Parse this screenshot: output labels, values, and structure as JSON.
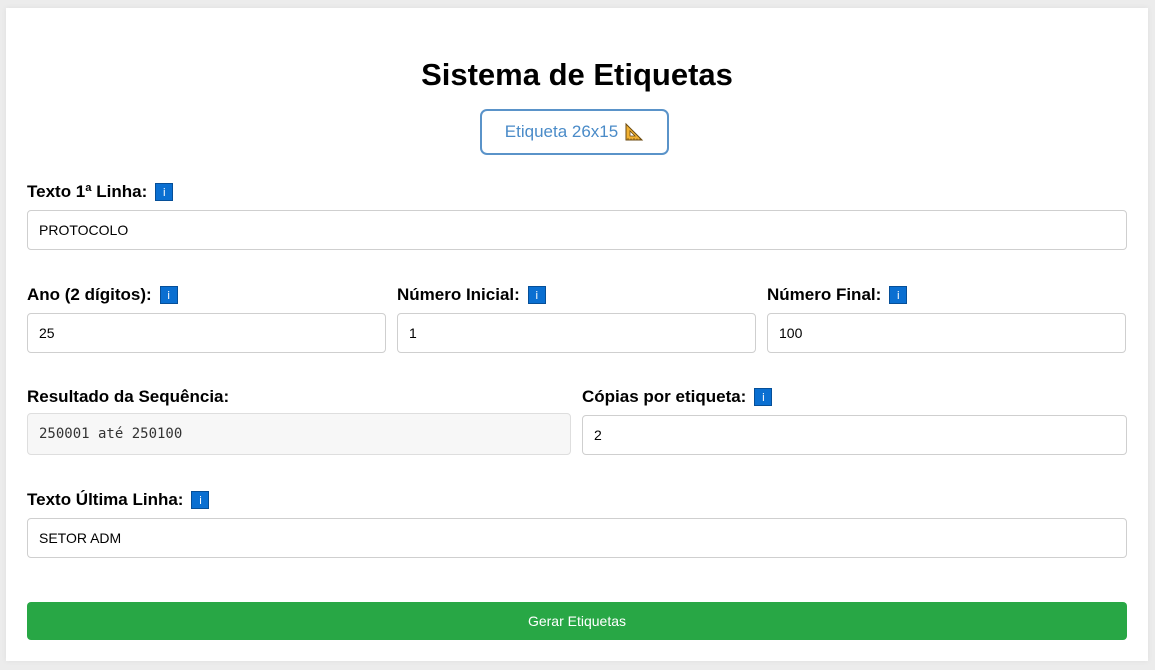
{
  "title": "Sistema de Etiquetas",
  "label_type_button": {
    "label": "Etiqueta 26x15",
    "icon": "triangular-ruler-icon"
  },
  "info_icon_glyph": "i",
  "fields": {
    "first_line": {
      "label": "Texto 1ª Linha:",
      "value": "PROTOCOLO"
    },
    "year": {
      "label": "Ano (2 dígitos):",
      "value": "25"
    },
    "start_number": {
      "label": "Número Inicial:",
      "value": "1"
    },
    "end_number": {
      "label": "Número Final:",
      "value": "100"
    },
    "sequence_result": {
      "label": "Resultado da Sequência:",
      "value": "250001 até 250100"
    },
    "copies": {
      "label": "Cópias por etiqueta:",
      "value": "2"
    },
    "last_line": {
      "label": "Texto Última Linha:",
      "value": "SETOR ADM"
    }
  },
  "submit_button": {
    "label": "Gerar Etiquetas"
  },
  "colors": {
    "accent_blue": "#4a8bc8",
    "info_icon": "#0a6fd1",
    "submit_green": "#28a745"
  }
}
